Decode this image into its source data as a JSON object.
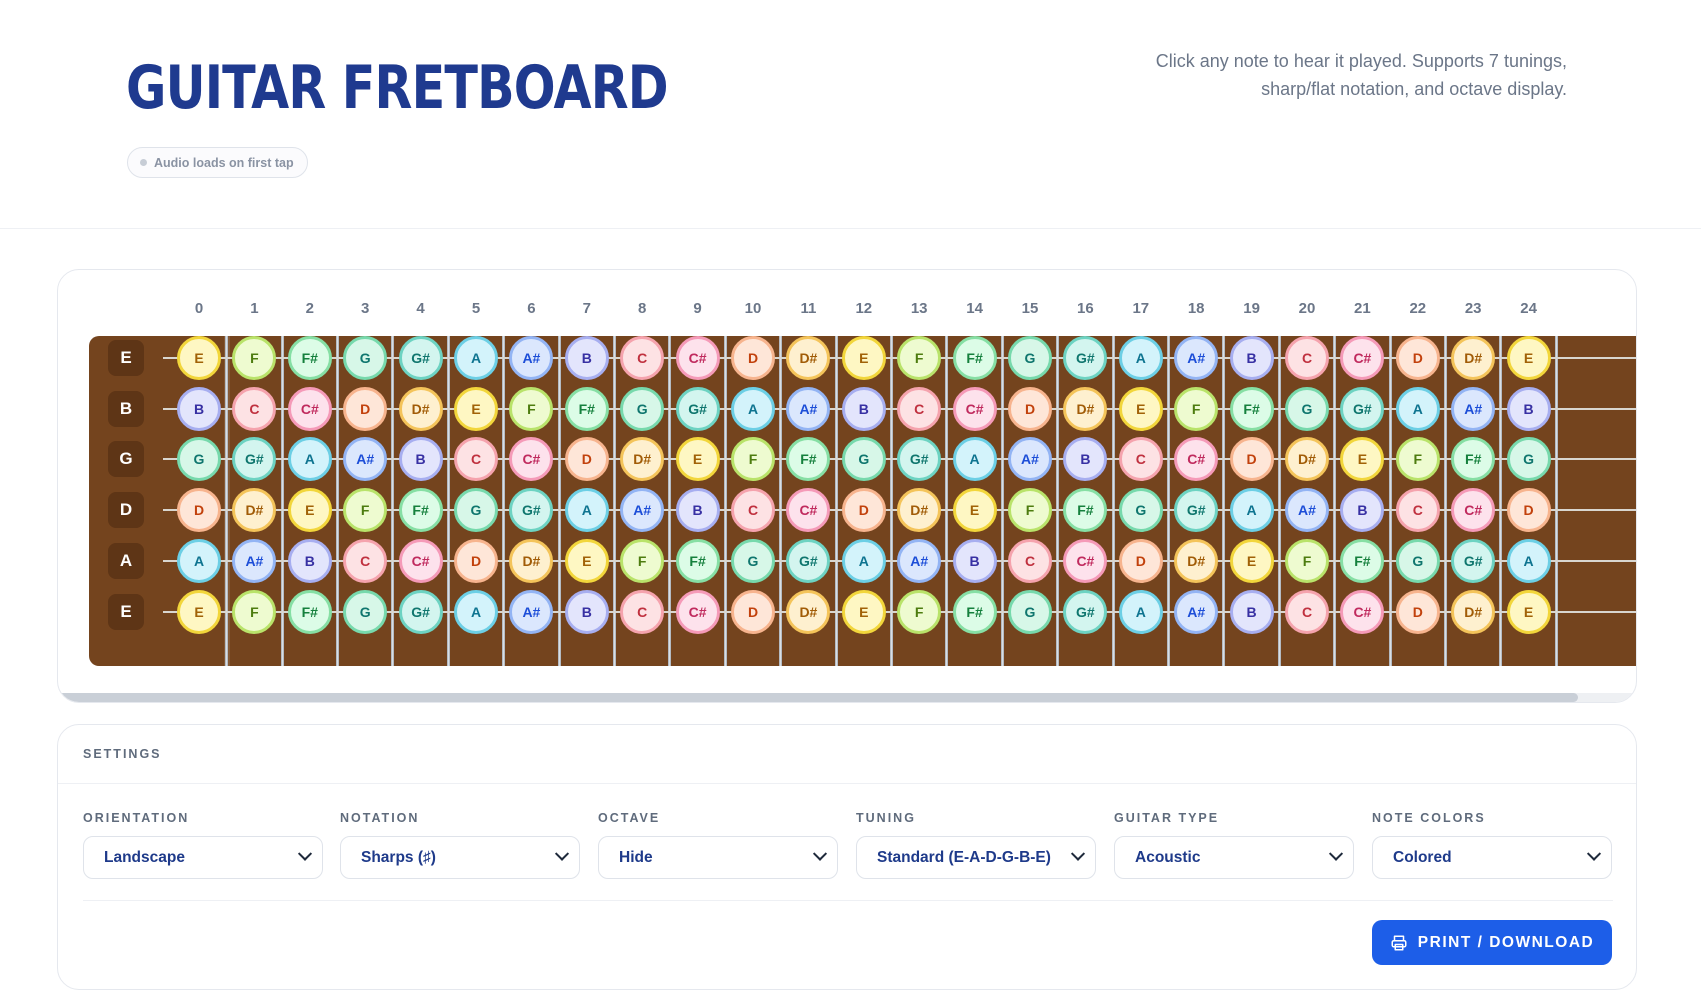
{
  "header": {
    "title": "GUITAR FRETBOARD",
    "audio_badge": "Audio loads on first tap",
    "description": "Click any note to hear it played. Supports 7 tunings, sharp/flat notation, and octave display."
  },
  "fretboard": {
    "fret_numbers": [
      "0",
      "1",
      "2",
      "3",
      "4",
      "5",
      "6",
      "7",
      "8",
      "9",
      "10",
      "11",
      "12",
      "13",
      "14",
      "15",
      "16",
      "17",
      "18",
      "19",
      "20",
      "21",
      "22",
      "23",
      "24"
    ],
    "strings": [
      {
        "label": "E",
        "notes": [
          "E",
          "F",
          "F#",
          "G",
          "G#",
          "A",
          "A#",
          "B",
          "C",
          "C#",
          "D",
          "D#",
          "E",
          "F",
          "F#",
          "G",
          "G#",
          "A",
          "A#",
          "B",
          "C",
          "C#",
          "D",
          "D#",
          "E"
        ]
      },
      {
        "label": "B",
        "notes": [
          "B",
          "C",
          "C#",
          "D",
          "D#",
          "E",
          "F",
          "F#",
          "G",
          "G#",
          "A",
          "A#",
          "B",
          "C",
          "C#",
          "D",
          "D#",
          "E",
          "F",
          "F#",
          "G",
          "G#",
          "A",
          "A#",
          "B"
        ]
      },
      {
        "label": "G",
        "notes": [
          "G",
          "G#",
          "A",
          "A#",
          "B",
          "C",
          "C#",
          "D",
          "D#",
          "E",
          "F",
          "F#",
          "G",
          "G#",
          "A",
          "A#",
          "B",
          "C",
          "C#",
          "D",
          "D#",
          "E",
          "F",
          "F#",
          "G"
        ]
      },
      {
        "label": "D",
        "notes": [
          "D",
          "D#",
          "E",
          "F",
          "F#",
          "G",
          "G#",
          "A",
          "A#",
          "B",
          "C",
          "C#",
          "D",
          "D#",
          "E",
          "F",
          "F#",
          "G",
          "G#",
          "A",
          "A#",
          "B",
          "C",
          "C#",
          "D"
        ]
      },
      {
        "label": "A",
        "notes": [
          "A",
          "A#",
          "B",
          "C",
          "C#",
          "D",
          "D#",
          "E",
          "F",
          "F#",
          "G",
          "G#",
          "A",
          "A#",
          "B",
          "C",
          "C#",
          "D",
          "D#",
          "E",
          "F",
          "F#",
          "G",
          "G#",
          "A"
        ]
      },
      {
        "label": "E",
        "notes": [
          "E",
          "F",
          "F#",
          "G",
          "G#",
          "A",
          "A#",
          "B",
          "C",
          "C#",
          "D",
          "D#",
          "E",
          "F",
          "F#",
          "G",
          "G#",
          "A",
          "A#",
          "B",
          "C",
          "C#",
          "D",
          "D#",
          "E"
        ]
      }
    ],
    "note_colors": {
      "C": {
        "bg": "#fde2e4",
        "border": "#f5a3ad",
        "text": "#c0313f"
      },
      "C#": {
        "bg": "#fde2ec",
        "border": "#f59ab8",
        "text": "#c02a5e"
      },
      "D": {
        "bg": "#fee6d8",
        "border": "#f7b48e",
        "text": "#c2410c"
      },
      "D#": {
        "bg": "#fef0cf",
        "border": "#f4c45a",
        "text": "#a15c07"
      },
      "E": {
        "bg": "#fef7c3",
        "border": "#f2d63b",
        "text": "#a16207"
      },
      "F": {
        "bg": "#eefbd0",
        "border": "#b9e36a",
        "text": "#4d7c0f"
      },
      "F#": {
        "bg": "#dcfce7",
        "border": "#86dfa4",
        "text": "#15803d"
      },
      "G": {
        "bg": "#d7f7e8",
        "border": "#77d9ac",
        "text": "#0f766e"
      },
      "G#": {
        "bg": "#d3f5ef",
        "border": "#6dd3c2",
        "text": "#0f766e"
      },
      "A": {
        "bg": "#d3f3fb",
        "border": "#6ccfe5",
        "text": "#0e7490"
      },
      "A#": {
        "bg": "#dbe7fd",
        "border": "#93b4f4",
        "text": "#1d4ed8"
      },
      "B": {
        "bg": "#e3e5fc",
        "border": "#a7aef0",
        "text": "#3730a3"
      }
    }
  },
  "settings": {
    "title": "SETTINGS",
    "fields": [
      {
        "label": "ORIENTATION",
        "value": "Landscape"
      },
      {
        "label": "NOTATION",
        "value": "Sharps (♯)"
      },
      {
        "label": "OCTAVE",
        "value": "Hide"
      },
      {
        "label": "TUNING",
        "value": "Standard (E-A-D-G-B-E)"
      },
      {
        "label": "GUITAR TYPE",
        "value": "Acoustic"
      },
      {
        "label": "NOTE COLORS",
        "value": "Colored"
      }
    ],
    "print_button": "PRINT / DOWNLOAD"
  }
}
